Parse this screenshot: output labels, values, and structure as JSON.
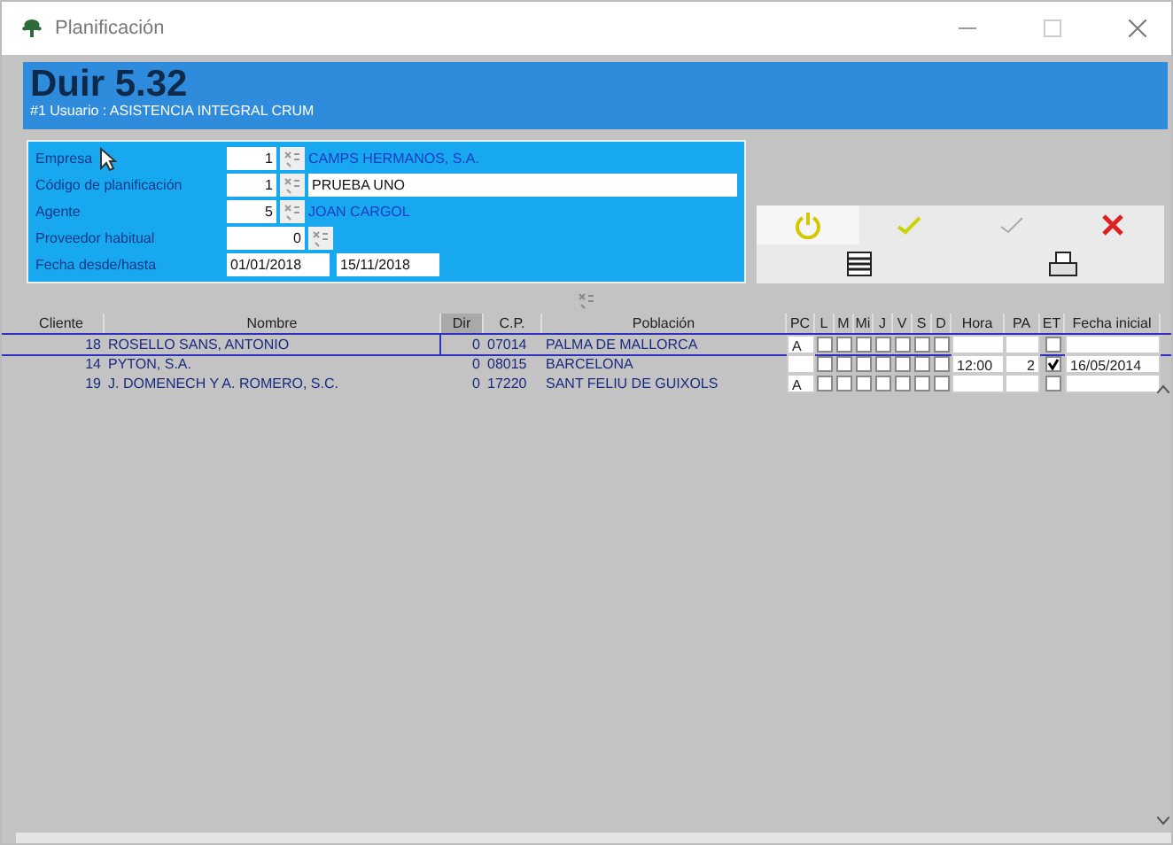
{
  "window": {
    "title": "Planificación"
  },
  "header": {
    "title": "Duir 5.32",
    "subtitle": "#1 Usuario : ASISTENCIA INTEGRAL CRUM"
  },
  "form": [
    {
      "label": "Empresa",
      "code": "1",
      "value": "CAMPS HERMANOS, S.A.",
      "kind": "link"
    },
    {
      "label": "Código de planificación",
      "code": "1",
      "value": "PRUEBA UNO",
      "kind": "input"
    },
    {
      "label": "Agente",
      "code": "5",
      "value": "JOAN CARGOL",
      "kind": "link"
    },
    {
      "label": "Proveedor habitual",
      "code": "0",
      "kind": "wide"
    },
    {
      "label": "Fecha desde/hasta",
      "from": "01/01/2018",
      "to": "15/11/2018",
      "kind": "dates"
    }
  ],
  "toolbar": [
    {
      "kind": "power",
      "disabled": false
    },
    {
      "kind": "accept",
      "disabled": false
    },
    {
      "kind": "accept",
      "disabled": true
    },
    {
      "kind": "cancel",
      "disabled": false
    }
  ],
  "toolbar2": [
    {
      "kind": "list"
    },
    {
      "kind": "print"
    }
  ],
  "table": {
    "columns": [
      "Cliente",
      "Nombre",
      "Dir",
      "C.P.",
      "Población",
      "PC",
      "L",
      "M",
      "Mi",
      "J",
      "V",
      "S",
      "D",
      "Hora",
      "PA",
      "ET",
      "Fecha inicial"
    ],
    "rows": [
      {
        "cliente": "18",
        "nombre": "ROSELLO SANS, ANTONIO",
        "dir": "0",
        "cp": "07014",
        "poblacion": "PALMA DE MALLORCA",
        "pc": "A",
        "days": [
          false,
          false,
          false,
          false,
          false,
          false,
          false
        ],
        "hora": "",
        "pa": "",
        "et": false,
        "fecha": "",
        "selected": true
      },
      {
        "cliente": "14",
        "nombre": "PYTON, S.A.",
        "dir": "0",
        "cp": "08015",
        "poblacion": "BARCELONA",
        "pc": "",
        "days": [
          false,
          false,
          false,
          false,
          false,
          false,
          false
        ],
        "hora": "12:00",
        "pa": "2",
        "et": true,
        "fecha": "16/05/2014",
        "selected": false
      },
      {
        "cliente": "19",
        "nombre": "J. DOMENECH Y A. ROMERO, S.C.",
        "dir": "0",
        "cp": "17220",
        "poblacion": "SANT FELIU DE GUIXOLS",
        "pc": "A",
        "days": [
          false,
          false,
          false,
          false,
          false,
          false,
          false
        ],
        "hora": "",
        "pa": "",
        "et": false,
        "fecha": "",
        "selected": false
      }
    ]
  }
}
